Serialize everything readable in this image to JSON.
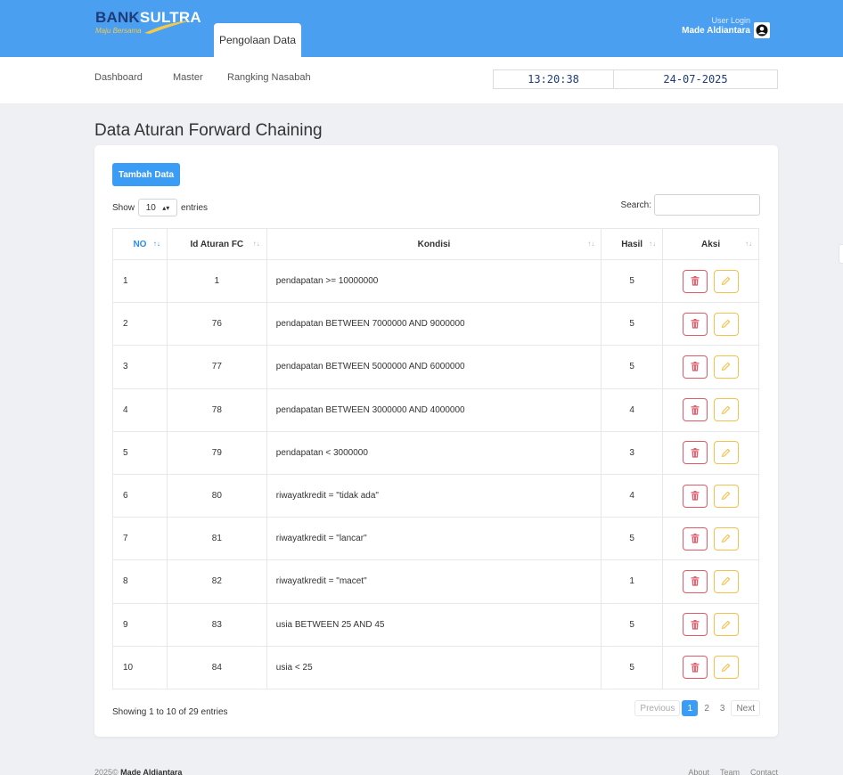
{
  "header": {
    "logo_prefix": "BANK",
    "logo_suffix": "SULTRA",
    "logo_tagline": "Maju Bersama",
    "active_tab": "Pengolaan Data",
    "user_label": "User Login",
    "user_name": "Made Aldiantara"
  },
  "nav": {
    "items": [
      "Dashboard",
      "Master",
      "Rangking Nasabah"
    ],
    "time": "13:20:38",
    "date": "24-07-2025"
  },
  "page": {
    "title": "Data Aturan Forward Chaining",
    "add_button": "Tambah Data",
    "show_label": "Show",
    "entries_label": "entries",
    "page_length": "10",
    "search_label": "Search:",
    "search_value": ""
  },
  "table": {
    "columns": [
      "NO",
      "Id Aturan FC",
      "Kondisi",
      "Hasil",
      "Aksi"
    ],
    "rows": [
      {
        "no": "1",
        "id": "1",
        "kondisi": "pendapatan >= 10000000",
        "hasil": "5"
      },
      {
        "no": "2",
        "id": "76",
        "kondisi": "pendapatan BETWEEN 7000000 AND 9000000",
        "hasil": "5"
      },
      {
        "no": "3",
        "id": "77",
        "kondisi": "pendapatan BETWEEN 5000000 AND 6000000",
        "hasil": "5"
      },
      {
        "no": "4",
        "id": "78",
        "kondisi": "pendapatan BETWEEN 3000000 AND 4000000",
        "hasil": "4"
      },
      {
        "no": "5",
        "id": "79",
        "kondisi": "pendapatan < 3000000",
        "hasil": "3"
      },
      {
        "no": "6",
        "id": "80",
        "kondisi": "riwayatkredit = \"tidak ada\"",
        "hasil": "4"
      },
      {
        "no": "7",
        "id": "81",
        "kondisi": "riwayatkredit = \"lancar\"",
        "hasil": "5"
      },
      {
        "no": "8",
        "id": "82",
        "kondisi": "riwayatkredit = \"macet\"",
        "hasil": "1"
      },
      {
        "no": "9",
        "id": "83",
        "kondisi": "usia BETWEEN 25 AND 45",
        "hasil": "5"
      },
      {
        "no": "10",
        "id": "84",
        "kondisi": "usia < 25",
        "hasil": "5"
      }
    ]
  },
  "pagination": {
    "info": "Showing 1 to 10 of 29 entries",
    "previous": "Previous",
    "pages": [
      "1",
      "2",
      "3"
    ],
    "current": "1",
    "next": "Next"
  },
  "footer": {
    "copyright": "2025©",
    "author": "Made Aldiantara",
    "links": [
      "About",
      "Team",
      "Contact"
    ]
  },
  "colors": {
    "header_bg": "#4a9ff0",
    "primary": "#3b9cf5",
    "delete": "#e05a6a",
    "edit": "#f4c14b"
  },
  "icons": {
    "delete": "trash-icon",
    "edit": "pencil-icon",
    "avatar": "user-circle-icon"
  }
}
